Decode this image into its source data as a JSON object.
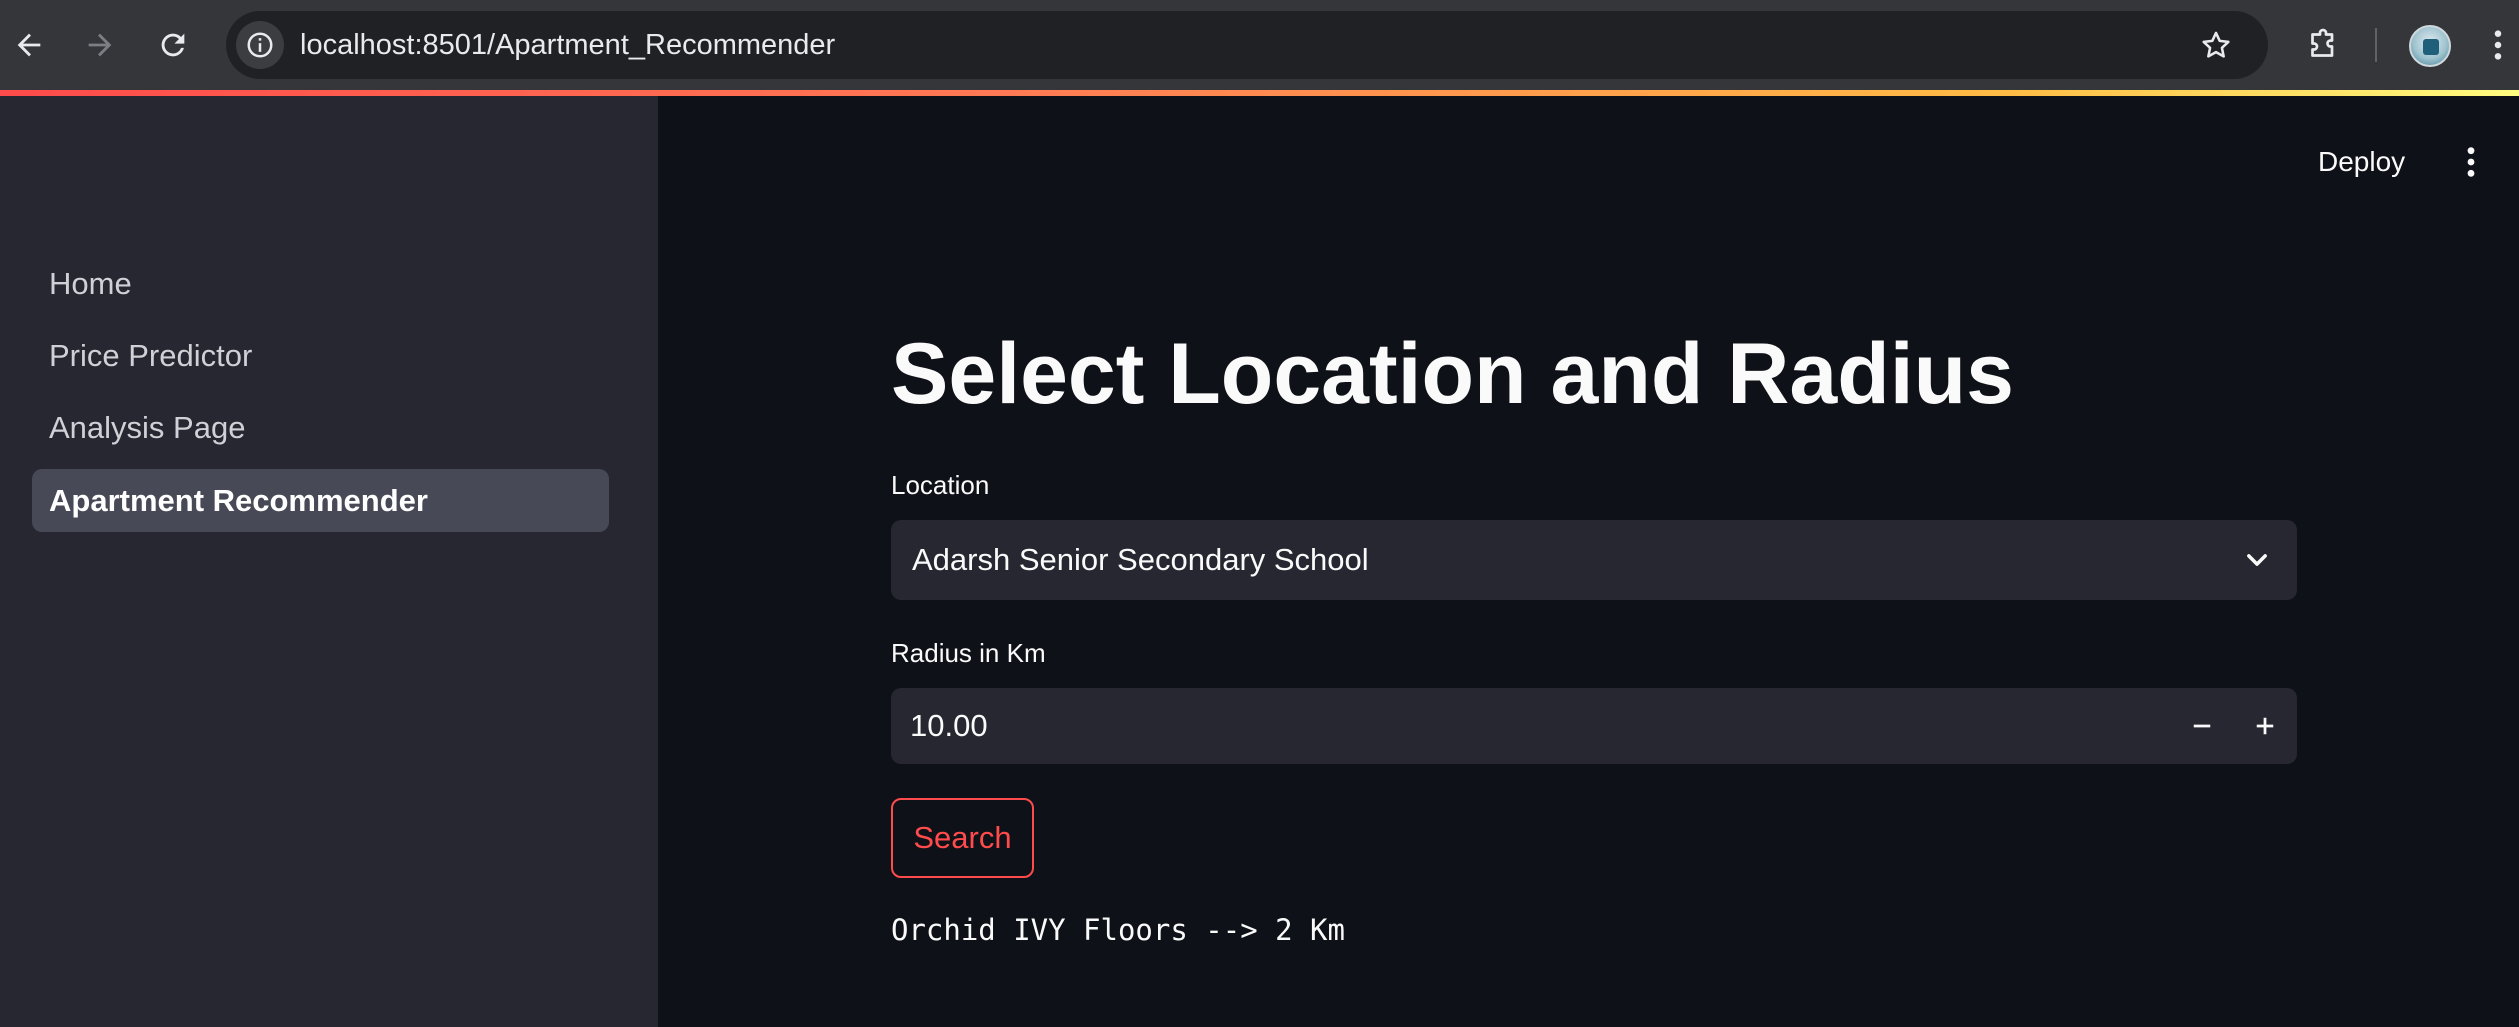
{
  "browser": {
    "url": "localhost:8501/Apartment_Recommender"
  },
  "sidebar": {
    "items": [
      {
        "label": "Home",
        "active": false
      },
      {
        "label": "Price Predictor",
        "active": false
      },
      {
        "label": "Analysis Page",
        "active": false
      },
      {
        "label": "Apartment Recommender",
        "active": true
      }
    ]
  },
  "header": {
    "deploy_label": "Deploy"
  },
  "main": {
    "title": "Select Location and Radius",
    "location": {
      "label": "Location",
      "value": "Adarsh Senior Secondary School"
    },
    "radius": {
      "label": "Radius in Km",
      "value": "10.00"
    },
    "search_label": "Search",
    "result": "Orchid IVY Floors --> 2 Km"
  },
  "colors": {
    "accent": "#ff4b4b",
    "background": "#0e1117",
    "sidebar_bg": "#262730",
    "input_bg": "#262730"
  },
  "icons": [
    "back-arrow-icon",
    "forward-arrow-icon",
    "reload-icon",
    "site-info-icon",
    "star-icon",
    "extensions-icon",
    "profile-avatar",
    "kebab-menu-icon",
    "chevron-down-icon",
    "minus-icon",
    "plus-icon"
  ]
}
